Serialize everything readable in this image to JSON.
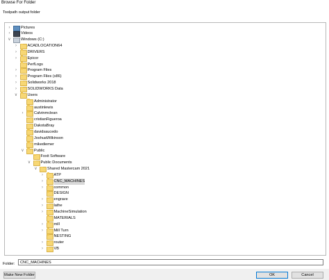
{
  "window": {
    "title": "Browse For Folder",
    "subtitle": "Toolpath output folder"
  },
  "tree": [
    {
      "label": "Pictures",
      "depth": 0,
      "expander": "collapsed",
      "icon": "pictures-icon"
    },
    {
      "label": "Videos",
      "depth": 0,
      "expander": "collapsed",
      "icon": "videos-icon"
    },
    {
      "label": "Windows (C:)",
      "depth": 0,
      "expander": "expanded",
      "icon": "drive-icon"
    },
    {
      "label": "ACADLOCATION64",
      "depth": 1,
      "expander": "collapsed",
      "icon": "folder-icon"
    },
    {
      "label": "DRIVERS",
      "depth": 1,
      "expander": "collapsed",
      "icon": "folder-icon"
    },
    {
      "label": "Epicor",
      "depth": 1,
      "expander": "collapsed",
      "icon": "folder-icon"
    },
    {
      "label": "PerfLogs",
      "depth": 1,
      "expander": "none",
      "icon": "folder-icon"
    },
    {
      "label": "Program Files",
      "depth": 1,
      "expander": "collapsed",
      "icon": "folder-icon"
    },
    {
      "label": "Program Files (x86)",
      "depth": 1,
      "expander": "collapsed",
      "icon": "folder-icon"
    },
    {
      "label": "Solidworks 2018",
      "depth": 1,
      "expander": "collapsed",
      "icon": "folder-icon"
    },
    {
      "label": "SOLIDWORKS Data",
      "depth": 1,
      "expander": "collapsed",
      "icon": "folder-icon"
    },
    {
      "label": "Users",
      "depth": 1,
      "expander": "expanded",
      "icon": "folder-icon"
    },
    {
      "label": "Administrator",
      "depth": 2,
      "expander": "none",
      "icon": "folder-icon"
    },
    {
      "label": "austinlewis",
      "depth": 2,
      "expander": "none",
      "icon": "folder-icon"
    },
    {
      "label": "Calvinmclean",
      "depth": 2,
      "expander": "collapsed",
      "icon": "folder-icon"
    },
    {
      "label": "cristianFigueroa",
      "depth": 2,
      "expander": "none",
      "icon": "folder-icon"
    },
    {
      "label": "DakotaBray",
      "depth": 2,
      "expander": "none",
      "icon": "folder-icon"
    },
    {
      "label": "davidsaucedo",
      "depth": 2,
      "expander": "none",
      "icon": "folder-icon"
    },
    {
      "label": "JoshuaWilkinson",
      "depth": 2,
      "expander": "none",
      "icon": "folder-icon"
    },
    {
      "label": "mikediemer",
      "depth": 2,
      "expander": "none",
      "icon": "folder-icon"
    },
    {
      "label": "Public",
      "depth": 2,
      "expander": "expanded",
      "icon": "folder-icon"
    },
    {
      "label": "Foxit Software",
      "depth": 3,
      "expander": "none",
      "icon": "folder-icon"
    },
    {
      "label": "Public Documents",
      "depth": 3,
      "expander": "expanded",
      "icon": "folder-icon"
    },
    {
      "label": "Shared Mastercam 2021",
      "depth": 4,
      "expander": "expanded",
      "icon": "folder-icon"
    },
    {
      "label": "ATP",
      "depth": 5,
      "expander": "collapsed",
      "icon": "folder-icon"
    },
    {
      "label": "CNC_MACHINES",
      "depth": 5,
      "expander": "collapsed",
      "icon": "folder-icon",
      "selected": true
    },
    {
      "label": "common",
      "depth": 5,
      "expander": "collapsed",
      "icon": "folder-icon"
    },
    {
      "label": "DESIGN",
      "depth": 5,
      "expander": "none",
      "icon": "folder-icon"
    },
    {
      "label": "engrave",
      "depth": 5,
      "expander": "collapsed",
      "icon": "folder-icon"
    },
    {
      "label": "lathe",
      "depth": 5,
      "expander": "collapsed",
      "icon": "folder-icon"
    },
    {
      "label": "MachineSimulation",
      "depth": 5,
      "expander": "collapsed",
      "icon": "folder-icon"
    },
    {
      "label": "MATERIALS",
      "depth": 5,
      "expander": "none",
      "icon": "folder-icon"
    },
    {
      "label": "mill",
      "depth": 5,
      "expander": "collapsed",
      "icon": "folder-icon"
    },
    {
      "label": "Mill Turn",
      "depth": 5,
      "expander": "collapsed",
      "icon": "folder-icon"
    },
    {
      "label": "NESTING",
      "depth": 5,
      "expander": "none",
      "icon": "folder-icon"
    },
    {
      "label": "router",
      "depth": 5,
      "expander": "collapsed",
      "icon": "folder-icon"
    },
    {
      "label": "VB",
      "depth": 5,
      "expander": "collapsed",
      "icon": "folder-icon"
    }
  ],
  "folder": {
    "label": "Folder:",
    "value": "CNC_MACHINES"
  },
  "buttons": {
    "make_new_folder": "Make New Folder",
    "ok": "OK",
    "cancel": "Cancel"
  }
}
